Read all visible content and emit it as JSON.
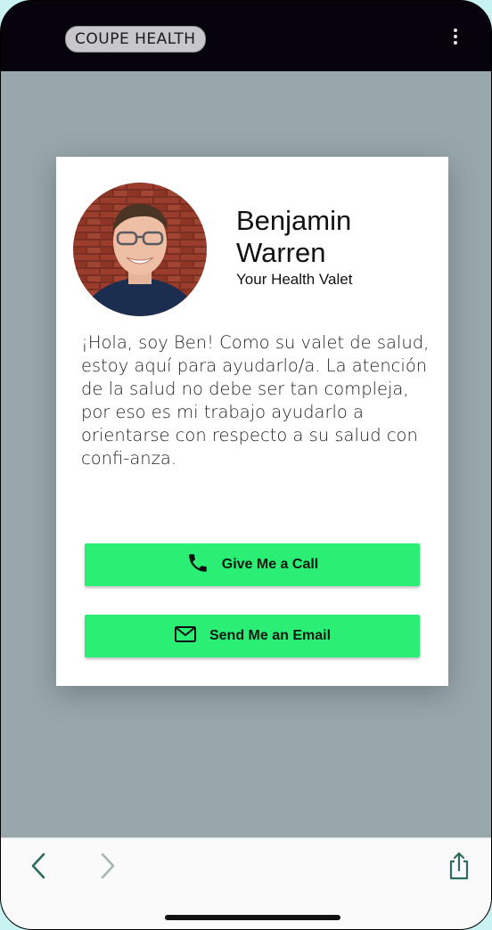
{
  "app": {
    "brand": "COUPE HEALTH"
  },
  "profile": {
    "name": "Benjamin Warren",
    "title": "Your Health Valet",
    "bio": "¡Hola, soy Ben! Como su valet de salud, estoy aquí para ayudarlo/a. La atención de la salud no debe ser tan compleja, por eso es mi trabajo ayudarlo a orientarse con respecto a su salud con confi-anza."
  },
  "actions": {
    "call_label": "Give Me a Call",
    "email_label": "Send Me an Email"
  },
  "icons": {
    "menu": "more-vertical-icon",
    "call": "phone-icon",
    "email": "mail-icon",
    "back": "chevron-left-icon",
    "forward": "chevron-right-icon",
    "share": "share-icon"
  },
  "colors": {
    "accent_button": "#2bee74",
    "overlay": "#98a7ab",
    "topbar": "#06030c",
    "nav_icon": "#2f6a5e"
  }
}
